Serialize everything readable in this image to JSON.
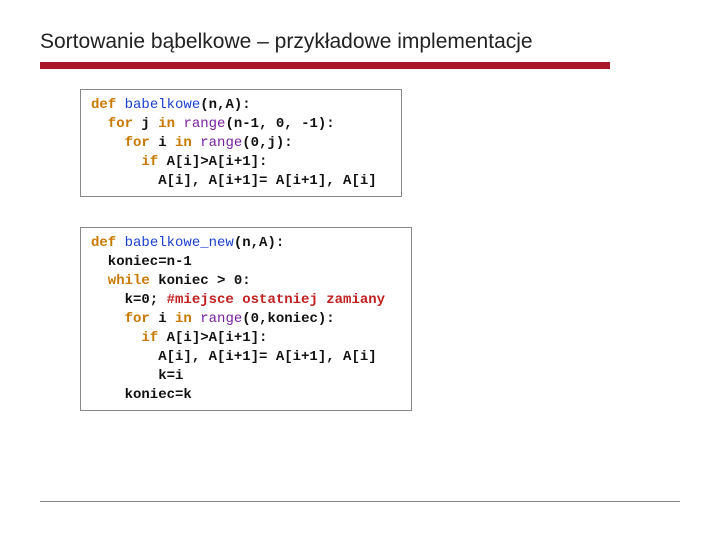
{
  "title": "Sortowanie bąbelkowe – przykładowe implementacje",
  "code1": {
    "l1_def": "def",
    "l1_name": " babelkowe",
    "l1_rest": "(n,A):",
    "l2_for": "  for",
    "l2_j": " j ",
    "l2_in": "in",
    "l2_range": " range",
    "l2_rest": "(n-1, 0, -1):",
    "l3_for": "    for",
    "l3_i": " i ",
    "l3_in": "in",
    "l3_range": " range",
    "l3_rest": "(0,j):",
    "l4_if": "      if",
    "l4_rest": " A[i]>A[i+1]:",
    "l5": "        A[i], A[i+1]= A[i+1], A[i]"
  },
  "code2": {
    "l1_def": "def",
    "l1_name": " babelkowe_new",
    "l1_rest": "(n,A):",
    "l2": "  koniec=n-1",
    "l3_while": "  while",
    "l3_rest": " koniec > 0:",
    "l4a": "    k=0; ",
    "l4b": "#miejsce ostatniej zamiany",
    "l5_for": "    for",
    "l5_i": " i ",
    "l5_in": "in",
    "l5_range": " range",
    "l5_rest": "(0,koniec):",
    "l6_if": "      if",
    "l6_rest": " A[i]>A[i+1]:",
    "l7": "        A[i], A[i+1]= A[i+1], A[i]",
    "l8": "        k=i",
    "l9": "    koniec=k"
  }
}
